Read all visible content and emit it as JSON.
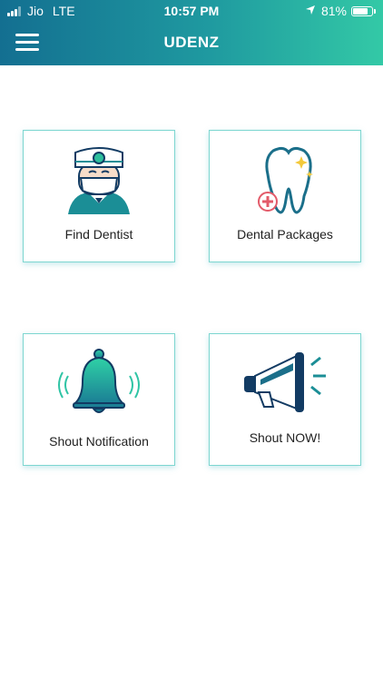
{
  "status_bar": {
    "carrier": "Jio",
    "network": "LTE",
    "time": "10:57 PM",
    "battery": "81%",
    "battery_level": 0.81,
    "location_icon": "location-arrow-icon"
  },
  "header": {
    "title": "UDENZ",
    "menu_icon": "hamburger-menu-icon"
  },
  "tiles": [
    {
      "label": "Find Dentist",
      "icon": "dentist-icon"
    },
    {
      "label": "Dental Packages",
      "icon": "tooth-icon"
    },
    {
      "label": "Shout Notification",
      "icon": "bell-icon"
    },
    {
      "label": "Shout NOW!",
      "icon": "megaphone-icon"
    }
  ],
  "colors": {
    "header_gradient_start": "#136f91",
    "header_gradient_end": "#33c9a6",
    "card_border": "#7dd6d0",
    "icon_teal": "#1b8e96",
    "icon_navy": "#123b63"
  }
}
